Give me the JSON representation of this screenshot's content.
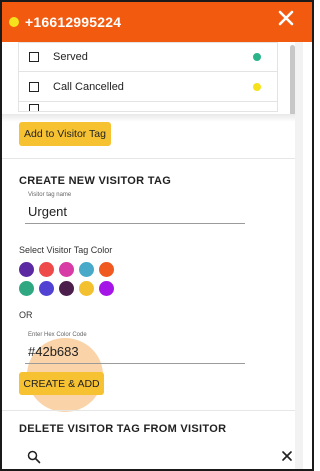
{
  "header": {
    "phone": "+16612995224",
    "status_color": "#f6e21c",
    "background_color": "#f15a0f",
    "close_icon": "close-icon"
  },
  "tag_list": {
    "items": [
      {
        "label": "Served",
        "color": "#2bb38a",
        "checked": false
      },
      {
        "label": "Call Cancelled",
        "color": "#f6e21c",
        "checked": false
      },
      {
        "label": "",
        "color": "",
        "checked": false
      }
    ]
  },
  "add_to_visitor_tag": {
    "label": "Add to Visitor Tag"
  },
  "create_section": {
    "title": "CREATE NEW VISITOR TAG",
    "name_field": {
      "label": "Visitor tag name",
      "value": "Urgent"
    },
    "color_label": "Select Visitor Tag Color",
    "colors": [
      "#5b2aa3",
      "#ee4a4a",
      "#d83ba5",
      "#48a9c9",
      "#f0591f",
      "#2fa882",
      "#5142d4",
      "#4b1e4b",
      "#f3c12f",
      "#a615e8"
    ],
    "or_label": "OR",
    "hex_field": {
      "label": "Enter Hex Color Code",
      "value": "#42b683"
    },
    "create_button": "CREATE & ADD"
  },
  "delete_section": {
    "title": "DELETE VISITOR TAG FROM VISITOR",
    "search_placeholder": "",
    "search_icon": "search-icon",
    "clear_icon": "close-icon"
  }
}
